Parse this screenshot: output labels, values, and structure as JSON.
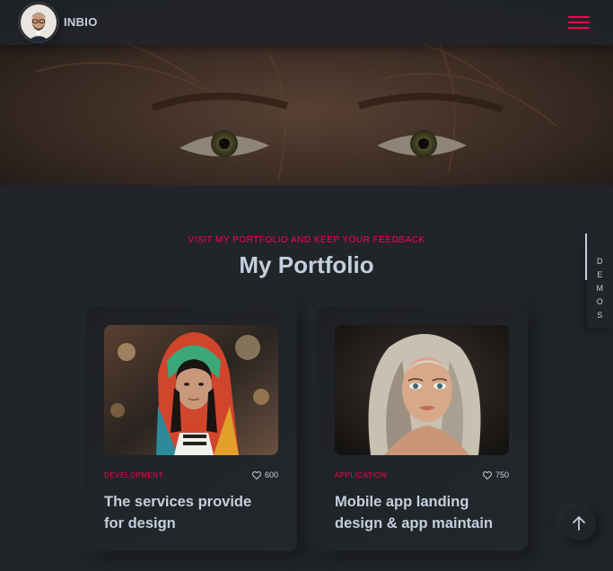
{
  "header": {
    "logo_text": "INBIO",
    "menu_icon": "hamburger-icon",
    "accent": "#ff014f"
  },
  "portfolio": {
    "subtitle": "VISIT MY PORTFOLIO AND KEEP YOUR FEEDBACK",
    "title": "My Portfolio",
    "cards": [
      {
        "category": "DEVELOPMENT",
        "likes": "600",
        "title_line1": "The services provide",
        "title_line2": "for design"
      },
      {
        "category": "APPLICATION",
        "likes": "750",
        "title_line1": "Mobile app landing",
        "title_line2": "design & app maintain"
      }
    ]
  },
  "sidebar": {
    "demos_letters": [
      "D",
      "E",
      "M",
      "O",
      "S"
    ]
  },
  "colors": {
    "background": "#212428",
    "text": "#c4cfde",
    "accent": "#ff014f"
  }
}
